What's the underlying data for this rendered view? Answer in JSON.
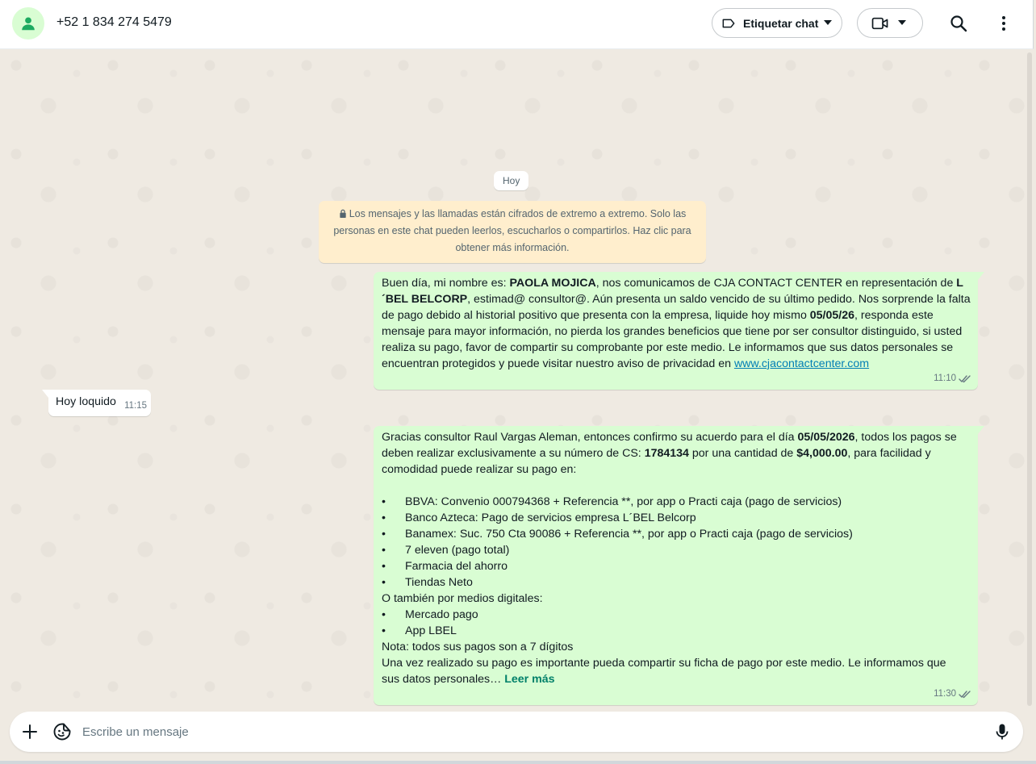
{
  "header": {
    "contact_name": "+52 1 834 274 5479",
    "label_button": "Etiquetar chat"
  },
  "chat": {
    "date_chip": "Hoy",
    "encryption_notice": "Los mensajes y las llamadas están cifrados de extremo a extremo. Solo las personas en este chat pueden leerlos, escucharlos o compartirlos. Haz clic para obtener más información.",
    "messages": [
      {
        "direction": "outgoing",
        "time": "11:10",
        "status": "read-ticks",
        "lines": [
          [
            "Buen día, mi nombre es: ",
            "PAOLA MOJICA",
            ", nos comunicamos de CJA CONTACT CENTER en representación de ",
            "L"
          ],
          [
            "´BEL BELCORP",
            ", estimad@ consultor@. Aún presenta un saldo vencido de su último pedido. Nos sorprende la falta"
          ],
          [
            "de pago debido al historial positivo que presenta con la empresa, liquide hoy mismo ",
            "05/05/26",
            ", responda este"
          ],
          [
            "mensaje para mayor información, no pierda los grandes beneficios que tiene por ser consultor distinguido, si usted"
          ],
          [
            "realiza su pago, favor de compartir su comprobante por este medio. Le informamos que sus datos personales se"
          ],
          [
            "encuentran protegidos y puede visitar nuestro aviso de privacidad en ",
            "www.cjacontactcenter.com"
          ]
        ]
      },
      {
        "direction": "incoming",
        "text": "Hoy loquido",
        "time": "11:15"
      },
      {
        "direction": "outgoing",
        "time": "11:30",
        "status": "read-ticks",
        "intro": [
          [
            "Gracias consultor Raul Vargas Aleman, entonces confirmo su acuerdo para el día ",
            "05/05/2026",
            ", todos los pagos se"
          ],
          [
            "deben realizar exclusivamente a su número de CS: ",
            "1784134",
            " por una cantidad de ",
            "$4,000.00",
            ", para facilidad y"
          ],
          [
            "comodidad puede realizar su pago en:"
          ]
        ],
        "bullet": "•",
        "bullets": [
          "BBVA: Convenio 000794368 + Referencia **, por app o Practi caja (pago de servicios)",
          "Banco Azteca: Pago de servicios empresa L´BEL Belcorp",
          "Banamex: Suc. 750 Cta 90086 + Referencia **, por app o Practi caja (pago de servicios)",
          "7 eleven (pago total)",
          "Farmacia del ahorro",
          "Tiendas Neto"
        ],
        "digital_heading": "O también por medios digitales:",
        "digital_bullets": [
          "Mercado pago",
          "App LBEL"
        ],
        "note": "Nota: todos sus pagos son a 7 dígitos",
        "closing_line1": "Una vez realizado su pago es importante pueda compartir su ficha de pago por este medio. Le informamos que",
        "closing_line2": "sus datos personales…",
        "read_more": "Leer más"
      }
    ]
  },
  "composer": {
    "placeholder": "Escribe un mensaje"
  },
  "colors": {
    "outgoing_bubble": "#d9fdd3",
    "incoming_bubble": "#ffffff",
    "chat_background": "#efeae2",
    "system_notice": "#ffeecd",
    "accent": "#008069",
    "link": "#027eb5"
  },
  "icons": {
    "avatar": "person-icon",
    "label": "tag-icon",
    "video": "video-camera-icon",
    "search": "search-icon",
    "menu": "more-vertical-icon",
    "attach": "plus-icon",
    "sticker": "sticker-icon",
    "mic": "microphone-icon",
    "lock": "lock-icon",
    "ticks": "double-check-icon"
  }
}
